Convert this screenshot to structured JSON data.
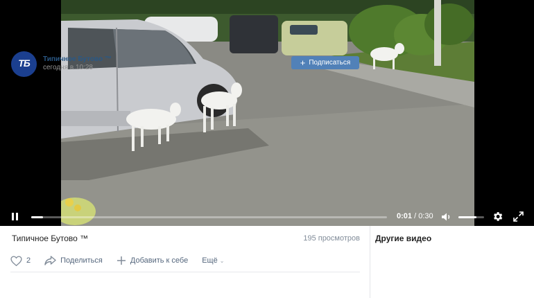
{
  "player": {
    "current_time": "0:01",
    "separator": " / ",
    "duration": "0:30",
    "progress_fraction": 0.033,
    "volume_fraction": 0.7,
    "scene_icons": [
      "car-icon",
      "goat-icon",
      "bush-icon"
    ]
  },
  "video": {
    "title": "Типичное Бутово ™",
    "views": "195 просмотров"
  },
  "actions": {
    "likes": "2",
    "share": "Поделиться",
    "add": "Добавить к себе",
    "more": "Ещё"
  },
  "author": {
    "avatar_text": "ТБ",
    "name": "Типичное Бутово ™",
    "posted": "сегодня в 10:28",
    "subscribe": "Подписаться"
  },
  "sidebar": {
    "title": "Другие видео"
  },
  "colors": {
    "accent": "#5181b8",
    "link": "#2a5885",
    "muted": "#818c99"
  }
}
